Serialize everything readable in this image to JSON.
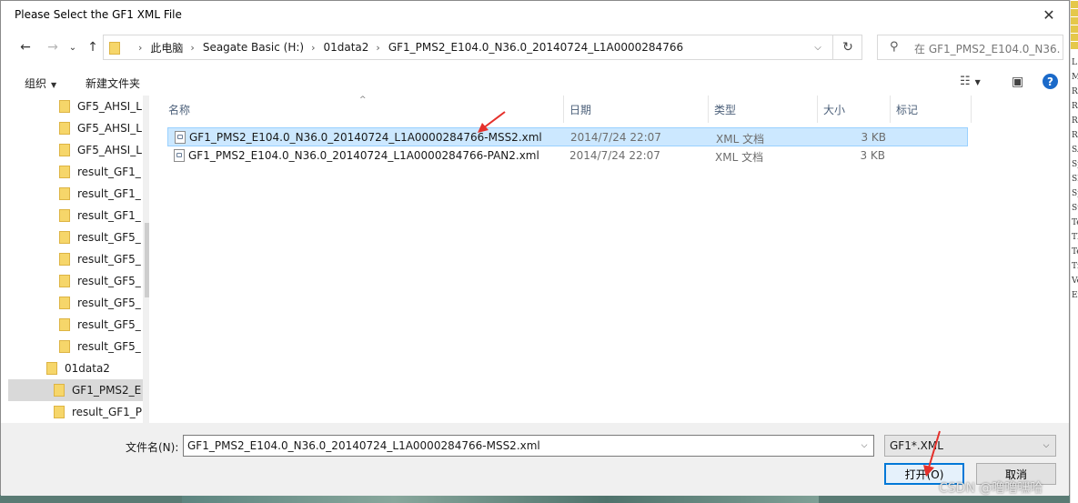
{
  "window": {
    "title": "Please Select the GF1 XML File",
    "close_glyph": "✕"
  },
  "nav": {
    "back_glyph": "←",
    "forward_glyph": "→",
    "recent_glyph": "⌄",
    "up_glyph": "↑",
    "breadcrumb": [
      "此电脑",
      "Seagate Basic (H:)",
      "01data2",
      "GF1_PMS2_E104.0_N36.0_20140724_L1A0000284766"
    ],
    "crumb_separator": "›",
    "dropdown_glyph": "⌵",
    "refresh_glyph": "↻",
    "search_placeholder": "在 GF1_PMS2_E104.0_N36....",
    "search_glyph": "⚲"
  },
  "toolbar": {
    "organize_label": "组织",
    "organize_arrow": "▼",
    "new_folder_label": "新建文件夹",
    "view_glyph": "☷",
    "view_arrow": "▼",
    "preview_glyph": "▣",
    "help_glyph": "?"
  },
  "tree": {
    "items": [
      {
        "label": "GF5_AHSI_L",
        "indent": 2,
        "selected": false
      },
      {
        "label": "GF5_AHSI_L",
        "indent": 2,
        "selected": false
      },
      {
        "label": "GF5_AHSI_L",
        "indent": 2,
        "selected": false
      },
      {
        "label": "result_GF1_",
        "indent": 2,
        "selected": false
      },
      {
        "label": "result_GF1_",
        "indent": 2,
        "selected": false
      },
      {
        "label": "result_GF1_",
        "indent": 2,
        "selected": false
      },
      {
        "label": "result_GF5_",
        "indent": 2,
        "selected": false
      },
      {
        "label": "result_GF5_",
        "indent": 2,
        "selected": false
      },
      {
        "label": "result_GF5_",
        "indent": 2,
        "selected": false
      },
      {
        "label": "result_GF5_",
        "indent": 2,
        "selected": false
      },
      {
        "label": "result_GF5_",
        "indent": 2,
        "selected": false
      },
      {
        "label": "result_GF5_",
        "indent": 2,
        "selected": false
      },
      {
        "label": "01data2",
        "indent": 1,
        "selected": false
      },
      {
        "label": "GF1_PMS2_E",
        "indent": 3,
        "selected": true
      },
      {
        "label": "result_GF1_P",
        "indent": 3,
        "selected": false
      }
    ]
  },
  "columns": [
    {
      "label": "名称"
    },
    {
      "label": "日期"
    },
    {
      "label": "类型"
    },
    {
      "label": "大小"
    },
    {
      "label": "标记"
    }
  ],
  "sort_glyph": "^",
  "files": [
    {
      "name": "GF1_PMS2_E104.0_N36.0_20140724_L1A0000284766-MSS2.xml",
      "date": "2014/7/24 22:07",
      "type": "XML 文档",
      "size": "3 KB",
      "selected": true
    },
    {
      "name": "GF1_PMS2_E104.0_N36.0_20140724_L1A0000284766-PAN2.xml",
      "date": "2014/7/24 22:07",
      "type": "XML 文档",
      "size": "3 KB",
      "selected": false
    }
  ],
  "footer": {
    "filename_label": "文件名(N):",
    "filename_value": "GF1_PMS2_E104.0_N36.0_20140724_L1A0000284766-MSS2.xml",
    "filter_value": "GF1*.XML",
    "dropdown_glyph": "⌵",
    "open_label": "打开(O)",
    "cancel_label": "取消"
  },
  "background": {
    "right_strip_labels": [
      "L:",
      "Me",
      "Re",
      "Re",
      "Re",
      "Re",
      "SA",
      "Sp",
      "SI",
      "Sp",
      "St",
      "Te",
      "Th",
      "Te",
      "Tr",
      "Ve",
      "Ex"
    ]
  },
  "watermark": "CSDN @噜噜嘿哈",
  "colors": {
    "selection": "#cce8ff",
    "selection_border": "#99d1ff",
    "accent": "#0078d7",
    "annotation_arrow": "#e5302b",
    "folder": "#f6d66a"
  }
}
